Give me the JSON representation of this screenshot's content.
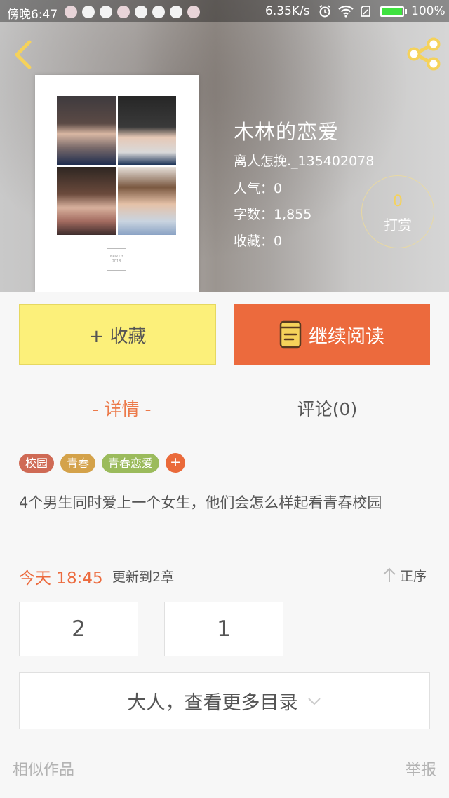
{
  "status_bar": {
    "time": "傍晚6:47",
    "network_speed": "6.35K/s",
    "battery_percent": "100%",
    "battery_level": 1.0,
    "notification_icons": [
      "app-notif-icon",
      "app-notif-icon",
      "app-notif-icon",
      "app-notif-icon",
      "app-notif-icon",
      "app-notif-icon",
      "app-notif-icon",
      "app-notif-icon"
    ]
  },
  "book": {
    "title": "木林的恋爱",
    "author": "离人怎挽._135402078",
    "popularity": "人气：0",
    "word_count": "字数：1,855",
    "favorites": "收藏：0"
  },
  "reward": {
    "count": "0",
    "label": "打赏"
  },
  "actions": {
    "collect_label": "+ 收藏",
    "continue_label": "继续阅读"
  },
  "tabs": {
    "detail": "- 详情 -",
    "comments": "评论(0)"
  },
  "tags": [
    {
      "label": "校园",
      "color": "#cf6a55"
    },
    {
      "label": "青春",
      "color": "#d4a24a"
    },
    {
      "label": "青春恋爱",
      "color": "#9bbb5c"
    }
  ],
  "tag_add": "+",
  "description": "4个男生同时爱上一个女生，他们会怎么样起看青春校园",
  "update": {
    "time": "今天 18:45",
    "text": "更新到2章",
    "sort_label": "正序"
  },
  "chapters": [
    "2",
    "1"
  ],
  "more_catalog": "大人，查看更多目录",
  "footer": {
    "similar": "相似作品",
    "report": "举报"
  },
  "colors": {
    "accent_orange": "#ec6a3d",
    "collect_yellow": "#fcf07a",
    "icon_yellow": "#f5d25a"
  }
}
